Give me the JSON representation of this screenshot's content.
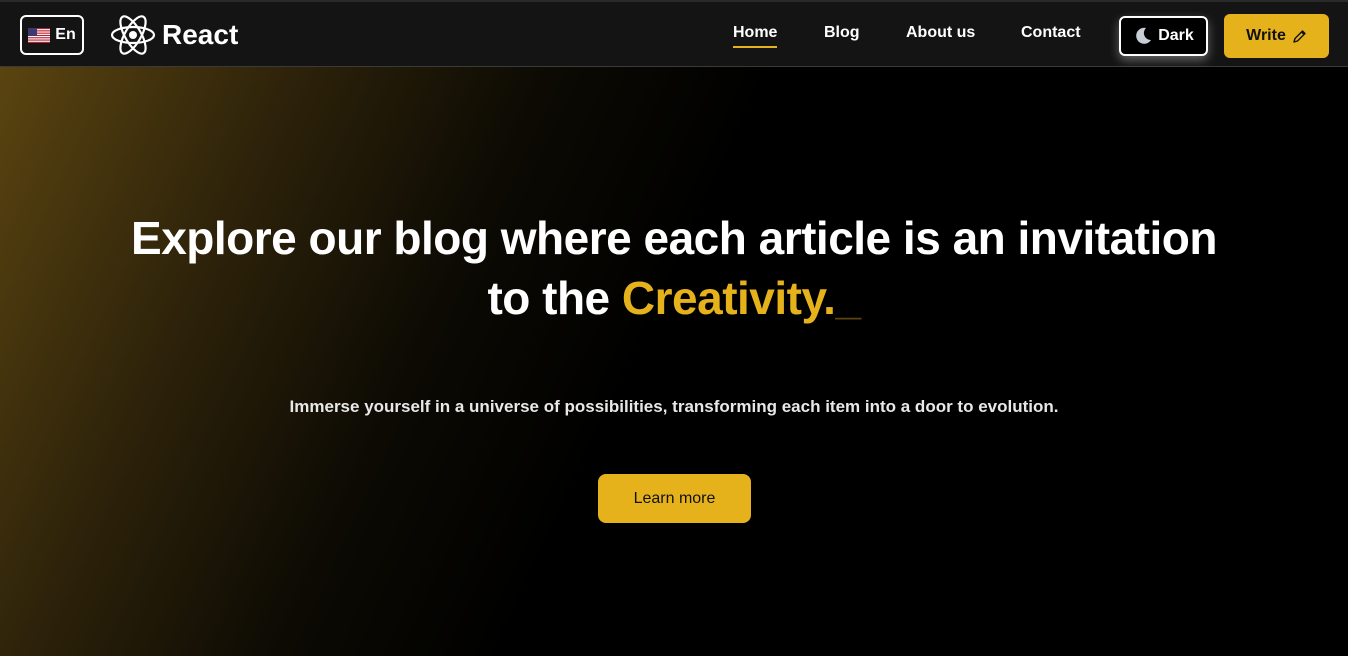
{
  "header": {
    "language": {
      "label": "En",
      "flag_icon": "us-flag-icon"
    },
    "brand": {
      "name": "React",
      "logo_icon": "react-atom-icon"
    },
    "nav": [
      {
        "label": "Home",
        "active": true
      },
      {
        "label": "Blog",
        "active": false
      },
      {
        "label": "About us",
        "active": false
      },
      {
        "label": "Contact",
        "active": false
      }
    ],
    "theme_toggle": {
      "label": "Dark",
      "icon": "moon-icon"
    },
    "write_button": {
      "label": "Write",
      "icon": "pencil-icon"
    }
  },
  "hero": {
    "headline_line1": "Explore our blog where each article is an invitation",
    "headline_line2": "to the",
    "headline_highlight": "Creativity.",
    "headline_cursor": "_",
    "subtitle": "Immerse yourself in a universe of possibilities, transforming each item into a door to evolution.",
    "cta_label": "Learn more"
  },
  "colors": {
    "accent": "#e6b21c",
    "navbar_bg": "#141414",
    "page_bg": "#000000"
  }
}
